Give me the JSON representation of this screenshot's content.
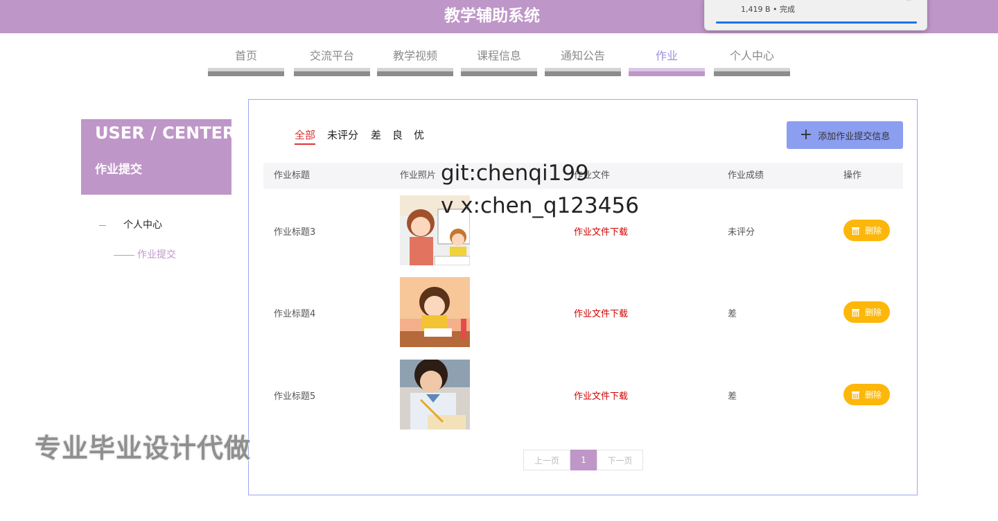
{
  "header": {
    "title": "教学辅助系统"
  },
  "download": {
    "status": "1,419 B • 完成"
  },
  "nav": {
    "items": [
      {
        "label": "首页"
      },
      {
        "label": "交流平台"
      },
      {
        "label": "教学视频"
      },
      {
        "label": "课程信息"
      },
      {
        "label": "通知公告"
      },
      {
        "label": "作业"
      },
      {
        "label": "个人中心"
      }
    ],
    "active": "作业"
  },
  "sidebar": {
    "title_en": "USER / CENTER",
    "title_cn": "作业提交",
    "menu": [
      {
        "label": "个人中心"
      },
      {
        "label": "作业提交"
      }
    ]
  },
  "filters": {
    "items": [
      {
        "label": "全部"
      },
      {
        "label": "未评分"
      },
      {
        "label": "差"
      },
      {
        "label": "良"
      },
      {
        "label": "优"
      }
    ],
    "active": "全部"
  },
  "actions": {
    "add_label": "添加作业提交信息"
  },
  "table": {
    "columns": [
      "作业标题",
      "作业照片",
      "作业文件",
      "作业成绩",
      "操作"
    ],
    "rows": [
      {
        "title": "作业标题3",
        "file_link": "作业文件下载",
        "score": "未评分",
        "delete_label": "删除",
        "photo": "cartoon-teacher-student"
      },
      {
        "title": "作业标题4",
        "file_link": "作业文件下载",
        "score": "差",
        "delete_label": "删除",
        "photo": "cartoon-girl-writing"
      },
      {
        "title": "作业标题5",
        "file_link": "作业文件下载",
        "score": "差",
        "delete_label": "删除",
        "photo": "child-writing-photo"
      }
    ]
  },
  "pagination": {
    "prev": "上一页",
    "current": "1",
    "next": "下一页"
  },
  "watermarks": {
    "git": "git:chenqi199",
    "vx": "v x:chen_q123456",
    "ad": "专业毕业设计代做"
  },
  "colors": {
    "header": "#bf96c8",
    "accent": "#bf96c8",
    "add_button": "#8c9ef0",
    "delete_button": "#fcb70a",
    "link_red": "#d00000"
  }
}
